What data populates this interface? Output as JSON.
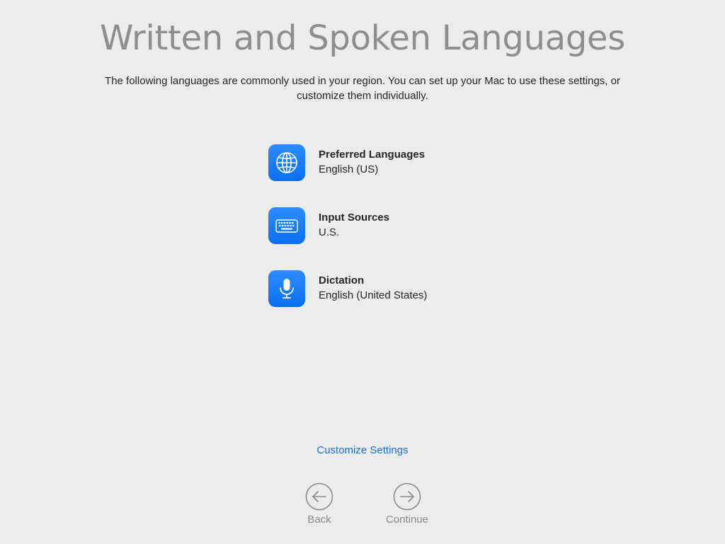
{
  "header": {
    "title": "Written and Spoken Languages",
    "subtitle": "The following languages are commonly used in your region. You can set up your Mac to use these settings, or customize them individually."
  },
  "items": [
    {
      "icon": "globe-icon",
      "title": "Preferred Languages",
      "value": "English (US)"
    },
    {
      "icon": "keyboard-icon",
      "title": "Input Sources",
      "value": "U.S."
    },
    {
      "icon": "microphone-icon",
      "title": "Dictation",
      "value": "English (United States)"
    }
  ],
  "actions": {
    "customize_label": "Customize Settings",
    "back_label": "Back",
    "continue_label": "Continue"
  },
  "colors": {
    "accent": "#1a6fd8",
    "icon_tile": "#0a6ff0",
    "background": "#ececec"
  }
}
